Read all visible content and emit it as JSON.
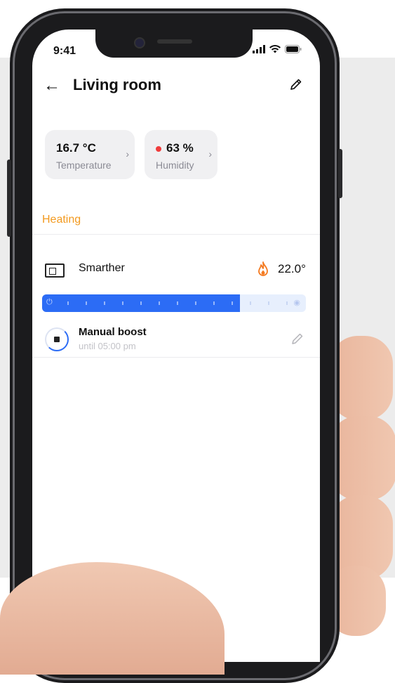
{
  "status_bar": {
    "time": "9:41"
  },
  "header": {
    "back_icon": "back-arrow-icon",
    "title": "Living room",
    "edit_icon": "pencil-icon"
  },
  "sensors": [
    {
      "value": "16.7 °C",
      "label": "Temperature",
      "indicator_color": ""
    },
    {
      "value": "63 %",
      "label": "Humidity",
      "indicator_color": "#f03c3c"
    }
  ],
  "section": {
    "title": "Heating",
    "color": "#f39a1f"
  },
  "thermostat": {
    "name": "Smarther",
    "set_temperature": "22.0°",
    "mode_icon": "flame-icon",
    "level_fraction": 0.75,
    "accent_color": "#2c6cf5"
  },
  "boost": {
    "title": "Manual boost",
    "subtitle": "until 05:00 pm",
    "edit_icon": "pencil-icon"
  }
}
